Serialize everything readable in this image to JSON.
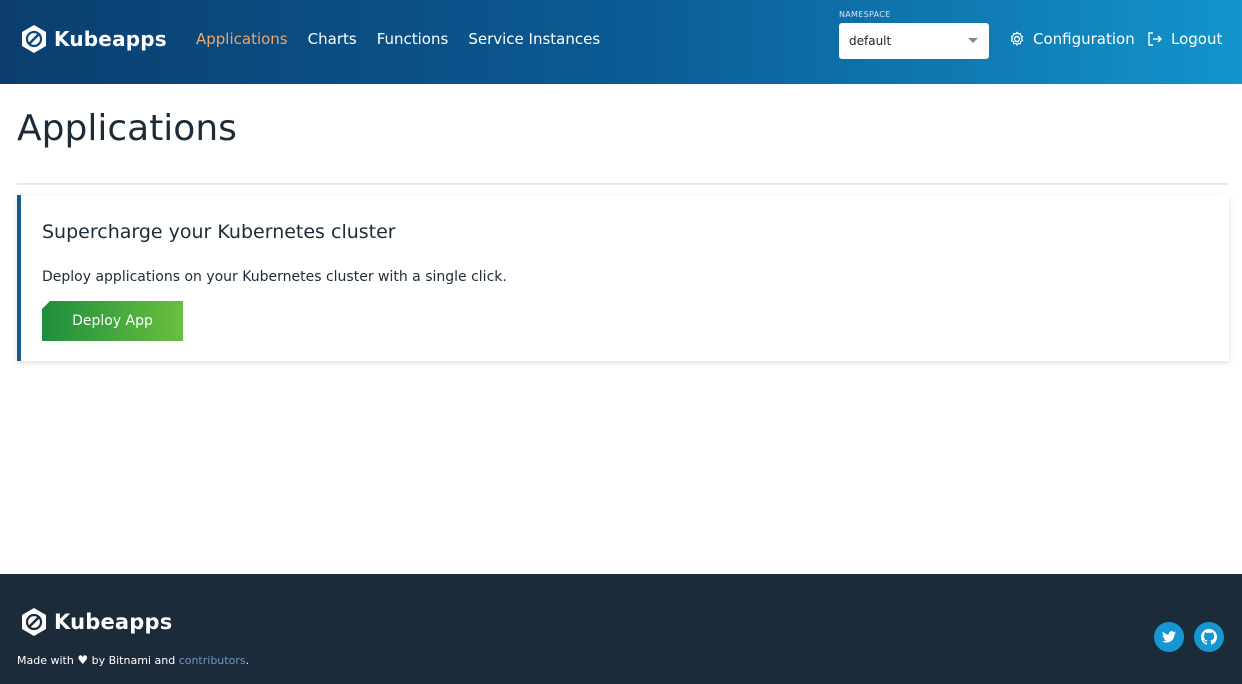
{
  "header": {
    "brand": "Kubeapps",
    "nav": [
      {
        "label": "Applications",
        "active": true
      },
      {
        "label": "Charts",
        "active": false
      },
      {
        "label": "Functions",
        "active": false
      },
      {
        "label": "Service Instances",
        "active": false
      }
    ],
    "namespace": {
      "label": "NAMESPACE",
      "value": "default"
    },
    "configuration": "Configuration",
    "logout": "Logout"
  },
  "main": {
    "title": "Applications",
    "card": {
      "heading": "Supercharge your Kubernetes cluster",
      "text": "Deploy applications on your Kubernetes cluster with a single click.",
      "button": "Deploy App"
    }
  },
  "footer": {
    "brand": "Kubeapps",
    "made_prefix": "Made with",
    "made_middle": "by Bitnami and",
    "contributors": "contributors",
    "made_suffix": "."
  },
  "colors": {
    "header_start": "#0b3e6f",
    "header_end": "#1394cc",
    "active_nav": "#f0a86a",
    "footer_bg": "#1c2b39",
    "button_start": "#1d8e3e",
    "button_end": "#6abf3e",
    "social": "#1796d1"
  }
}
